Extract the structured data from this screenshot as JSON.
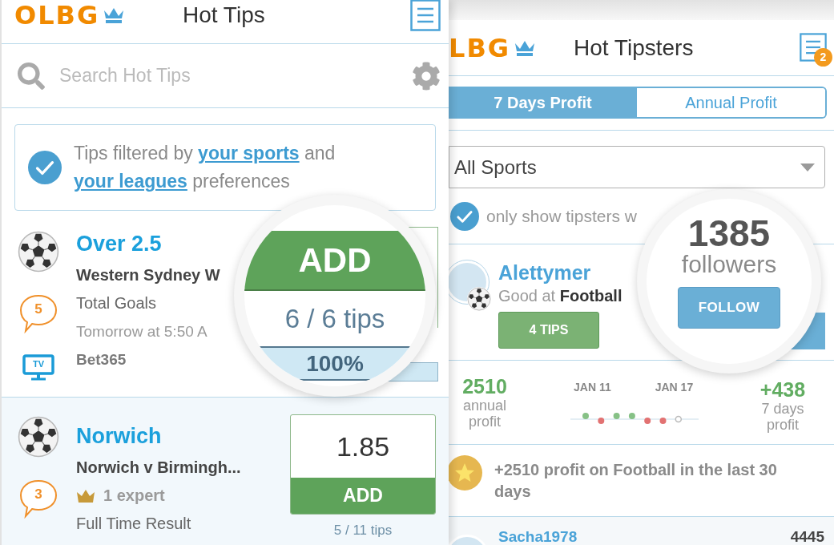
{
  "left_screen": {
    "header": {
      "logo": "OLBG",
      "title": "Hot Tips"
    },
    "search": {
      "placeholder": "Search Hot Tips"
    },
    "filter_notice": {
      "checked": true,
      "parts": [
        {
          "kind": "text",
          "text": "Tips filtered by "
        },
        {
          "kind": "link",
          "text": "your sports"
        },
        {
          "kind": "text",
          "text": " and "
        },
        {
          "kind": "link",
          "text": "your leagues"
        },
        {
          "kind": "text",
          "text": " preferences"
        }
      ]
    },
    "tips": [
      {
        "selected": false,
        "title": "Over 2.5",
        "comments": "5",
        "tv_label": "TV",
        "lines": [
          {
            "kind": "event",
            "text": "Western Sydney W"
          },
          {
            "kind": "market",
            "text": "Total Goals"
          },
          {
            "kind": "time",
            "text": "Tomorrow at 5:50 A"
          },
          {
            "kind": "bookmaker",
            "text": "Bet365"
          }
        ],
        "magnified": {
          "add": "ADD",
          "tips_count": "6 / 6 tips",
          "percent": "100%",
          "level": 1
        }
      },
      {
        "selected": true,
        "title": "Norwich",
        "comments": "3",
        "lines": [
          {
            "kind": "event",
            "text": "Norwich v Birmingh..."
          },
          {
            "kind": "experts",
            "text": "1 expert"
          },
          {
            "kind": "market",
            "text": "Full Time Result"
          }
        ],
        "odds": "1.85",
        "add": "ADD",
        "tips_count": "5 / 11 tips"
      }
    ]
  },
  "right_screen": {
    "header": {
      "logo": "LBG",
      "title": "Hot Tipsters",
      "notifications": "2"
    },
    "tabs": [
      {
        "label": "7 Days Profit",
        "selected": true
      },
      {
        "label": "Annual Profit",
        "selected": false
      }
    ],
    "sport_select": {
      "value": "All Sports"
    },
    "filter_option": {
      "label": "only show tipsters w",
      "checked": true
    },
    "tipsters": [
      {
        "name": "Alettymer",
        "specialty": "Good at **Football**",
        "tips_button": "4 TIPS",
        "magnified": {
          "followers": "1385",
          "followers_label": "followers",
          "follow_button": "FOLLOW"
        },
        "annual_profit": "2510",
        "annual_label": "annual profit",
        "dates": [
          "JAN 11",
          "JAN 17"
        ],
        "form": [
          {
            "kind": "win",
            "color": "#86c186"
          },
          {
            "kind": "loss",
            "color": "#e27272"
          },
          {
            "kind": "win",
            "color": "#86c186"
          },
          {
            "kind": "win",
            "color": "#86c186"
          },
          {
            "kind": "loss",
            "color": "#e27272"
          },
          {
            "kind": "loss",
            "color": "#e27272"
          },
          {
            "kind": "pending",
            "color": "#bbbbbb"
          }
        ],
        "week_profit": "+438",
        "week_label": "7 days profit",
        "highlight": "+2510 profit on Football in the last 30 days"
      },
      {
        "name": "Sacha1978",
        "stat": "4445"
      }
    ]
  }
}
